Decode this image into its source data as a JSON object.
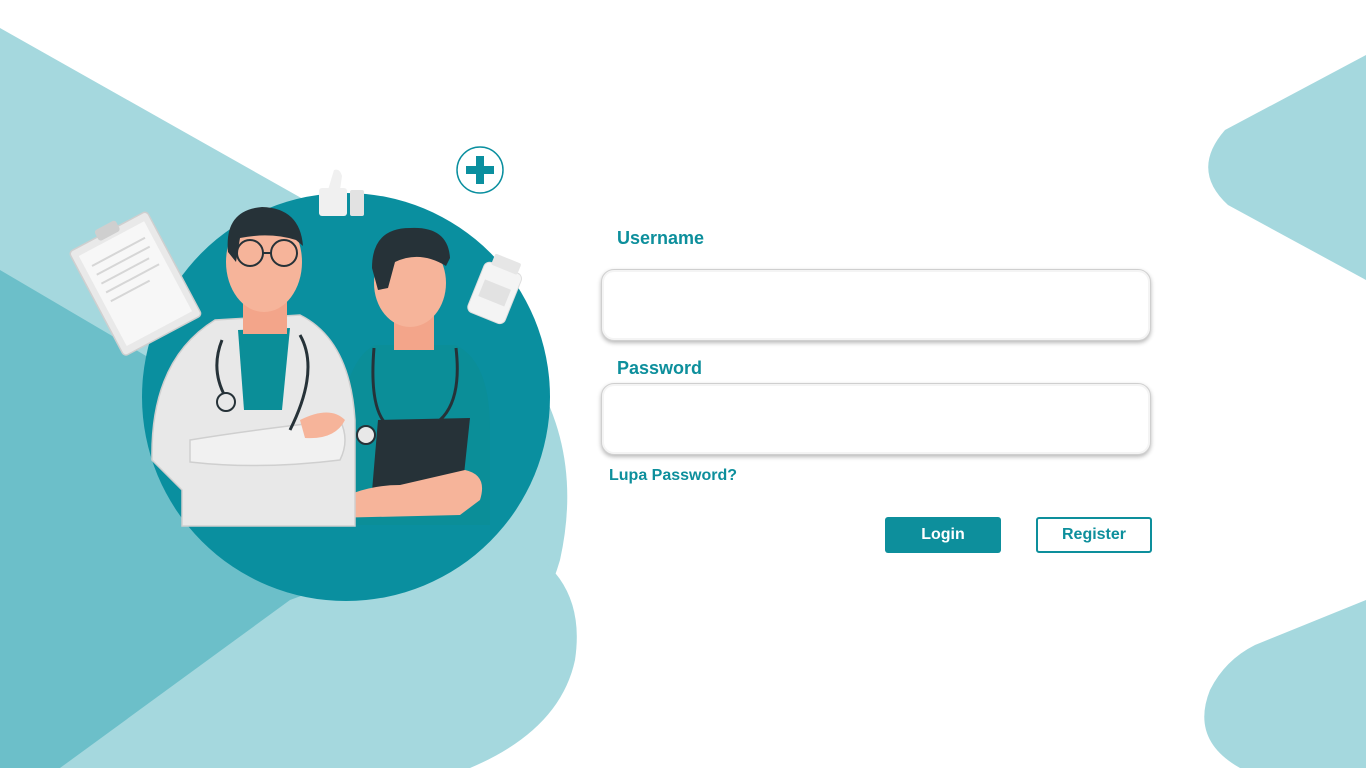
{
  "form": {
    "username_label": "Username",
    "username_value": "",
    "password_label": "Password",
    "password_value": "",
    "forgot_link": "Lupa Password?",
    "login_label": "Login",
    "register_label": "Register"
  },
  "colors": {
    "accent": "#0d8f9c",
    "bg_shape_light": "#a5d8de",
    "bg_shape_mid": "#6cbfc9",
    "illustration_circle": "#0a8f9f"
  },
  "icons": [
    "plus-icon",
    "thumbs-up-icon",
    "clipboard-icon",
    "pill-bottle-icon"
  ]
}
